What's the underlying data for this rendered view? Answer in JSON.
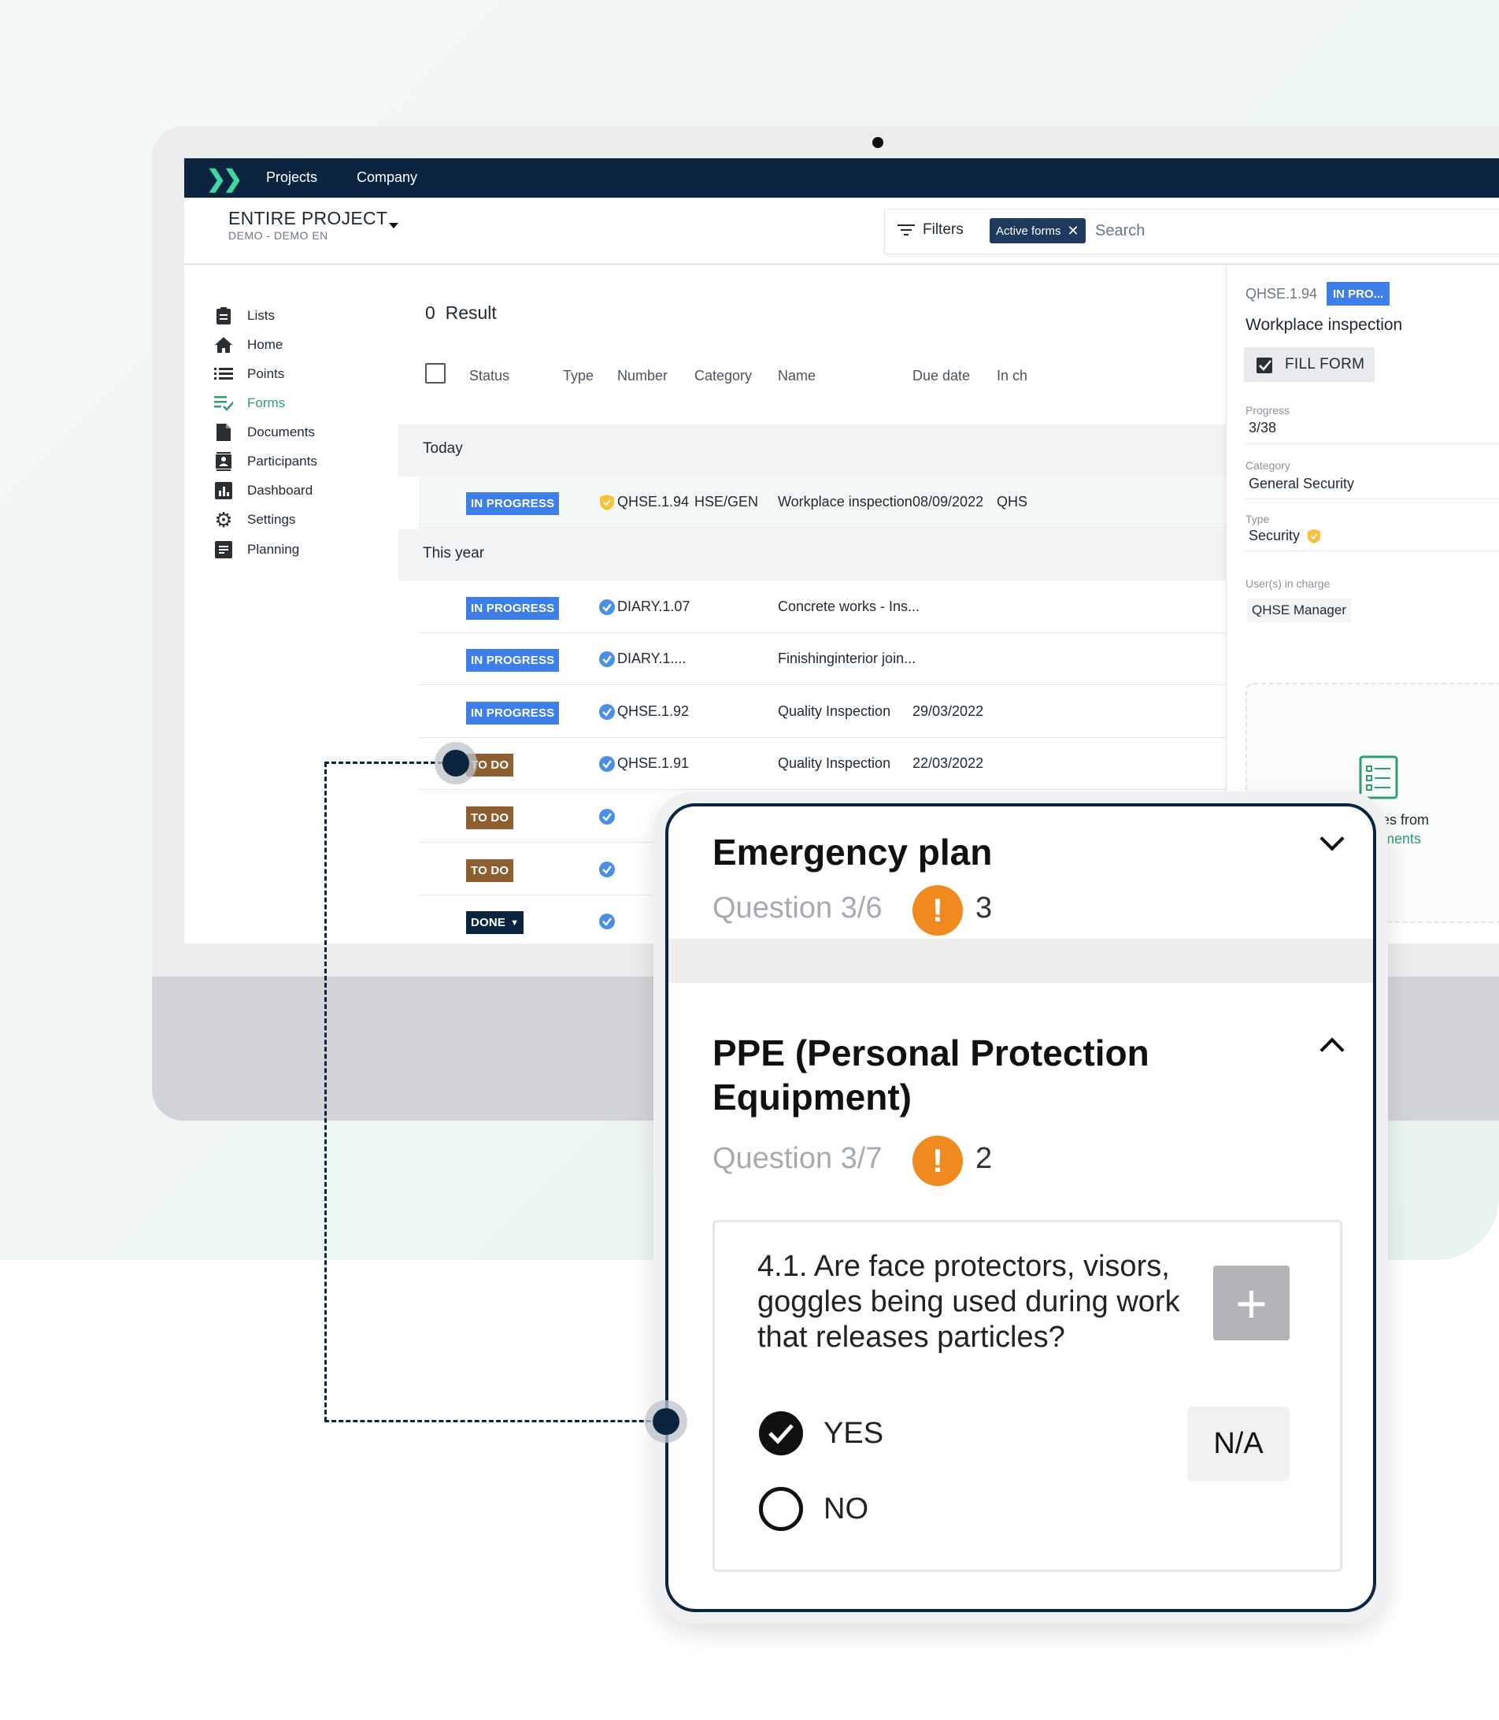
{
  "topbar": {
    "nav": [
      "Projects",
      "Company"
    ]
  },
  "project": {
    "title": "ENTIRE PROJECT",
    "subtitle": "DEMO - DEMO EN"
  },
  "search": {
    "filters_label": "Filters",
    "chip_label": "Active forms",
    "placeholder": "Search"
  },
  "sidebar": {
    "items": [
      {
        "label": "Lists",
        "icon": "clipboard-icon"
      },
      {
        "label": "Home",
        "icon": "home-icon"
      },
      {
        "label": "Points",
        "icon": "list-icon"
      },
      {
        "label": "Forms",
        "icon": "forms-check-icon",
        "active": true
      },
      {
        "label": "Documents",
        "icon": "document-icon"
      },
      {
        "label": "Participants",
        "icon": "contacts-icon"
      },
      {
        "label": "Dashboard",
        "icon": "bar-chart-icon"
      },
      {
        "label": "Settings",
        "icon": "gear-icon"
      },
      {
        "label": "Planning",
        "icon": "planning-icon"
      }
    ]
  },
  "results": {
    "count": "0",
    "label": "Result"
  },
  "table": {
    "columns": [
      "Status",
      "Type",
      "Number",
      "Category",
      "Name",
      "Due date",
      "In ch"
    ],
    "groups": [
      "Today",
      "This year"
    ],
    "today_rows": [
      {
        "status": "IN PROGRESS",
        "type": "shield-icon",
        "number": "QHSE.1.94",
        "category": "HSE/GEN",
        "name": "Workplace inspection",
        "due": "08/09/2022",
        "in_charge": "QHS"
      }
    ],
    "year_rows": [
      {
        "status": "IN PROGRESS",
        "type": "verified-icon",
        "number": "DIARY.1.07",
        "category": "",
        "name": "Concrete works - Ins...",
        "due": ""
      },
      {
        "status": "IN PROGRESS",
        "type": "verified-icon",
        "number": "DIARY.1....",
        "category": "",
        "name": "Finishinginterior join...",
        "due": ""
      },
      {
        "status": "IN PROGRESS",
        "type": "verified-icon",
        "number": "QHSE.1.92",
        "category": "",
        "name": "Quality Inspection",
        "due": "29/03/2022"
      },
      {
        "status": "TO DO",
        "type": "verified-icon",
        "number": "QHSE.1.91",
        "category": "",
        "name": "Quality Inspection",
        "due": "22/03/2022"
      },
      {
        "status": "TO DO",
        "type": "verified-icon",
        "number": "",
        "category": "",
        "name": "",
        "due": ""
      },
      {
        "status": "TO DO",
        "type": "verified-icon",
        "number": "",
        "category": "",
        "name": "",
        "due": ""
      },
      {
        "status": "DONE",
        "type": "verified-icon",
        "number": "",
        "category": "",
        "name": "",
        "due": ""
      }
    ]
  },
  "detail": {
    "number": "QHSE.1.94",
    "badge": "IN PRO...",
    "title": "Workplace inspection",
    "fill_button": "FILL FORM",
    "progress_label": "Progress",
    "progress_value": "3/38",
    "category_label": "Category",
    "category_value": "General Security",
    "type_label": "Type",
    "type_value": "Security",
    "users_label": "User(s) in charge",
    "users_value": "QHSE Manager",
    "drop_text1": "files from",
    "drop_text2": "uments"
  },
  "card": {
    "section1": {
      "title": "Emergency plan",
      "question": "Question 3/6",
      "warnings": "3"
    },
    "section2": {
      "title_line1": "PPE (Personal Protection",
      "title_line2": "Equipment)",
      "question": "Question 3/7",
      "warnings": "2"
    },
    "question_text": "4.1. Are face protectors, visors, goggles being used during work that releases particles?",
    "options": [
      "YES",
      "NO"
    ],
    "na_label": "N/A",
    "plus_label": "+"
  },
  "colors": {
    "navy": "#0b2540",
    "accent_green": "#2f9e6e",
    "in_progress": "#3d7ee8",
    "todo": "#8d5e30",
    "warning": "#f08a1e"
  }
}
